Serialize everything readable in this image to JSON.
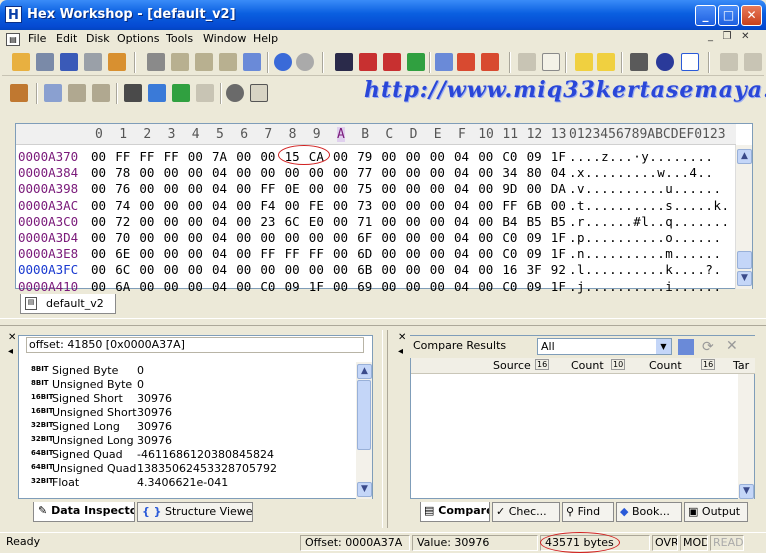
{
  "window": {
    "title": "Hex Workshop - [default_v2]",
    "app_icon": "H"
  },
  "menu": [
    "File",
    "Edit",
    "Disk",
    "Options",
    "Tools",
    "Window",
    "Help"
  ],
  "watermark_url": "http://www.miq33kertasemaya.tk",
  "hex": {
    "col_headers": [
      "0",
      "1",
      "2",
      "3",
      "4",
      "5",
      "6",
      "7",
      "8",
      "9",
      "A",
      "B",
      "C",
      "D",
      "E",
      "F",
      "10",
      "11",
      "12",
      "13"
    ],
    "ascii_header": "0123456789ABCDEF0123",
    "rows": [
      {
        "addr": "0000A370",
        "bytes": [
          "00",
          "FF",
          "FF",
          "FF",
          "00",
          "7A",
          "00",
          "00",
          "15",
          "CA",
          "00",
          "79",
          "00",
          "00",
          "00",
          "04",
          "00",
          "C0",
          "09",
          "1F"
        ],
        "ascii": "....z...·y........"
      },
      {
        "addr": "0000A384",
        "bytes": [
          "00",
          "78",
          "00",
          "00",
          "00",
          "04",
          "00",
          "00",
          "00",
          "00",
          "00",
          "77",
          "00",
          "00",
          "00",
          "04",
          "00",
          "34",
          "80",
          "04"
        ],
        "ascii": ".x.........w...4.."
      },
      {
        "addr": "0000A398",
        "bytes": [
          "00",
          "76",
          "00",
          "00",
          "00",
          "04",
          "00",
          "FF",
          "0E",
          "00",
          "00",
          "75",
          "00",
          "00",
          "00",
          "04",
          "00",
          "9D",
          "00",
          "DA"
        ],
        "ascii": ".v..........u......"
      },
      {
        "addr": "0000A3AC",
        "bytes": [
          "00",
          "74",
          "00",
          "00",
          "00",
          "04",
          "00",
          "F4",
          "00",
          "FE",
          "00",
          "73",
          "00",
          "00",
          "00",
          "04",
          "00",
          "FF",
          "6B",
          "00"
        ],
        "ascii": ".t..........s.....k."
      },
      {
        "addr": "0000A3C0",
        "bytes": [
          "00",
          "72",
          "00",
          "00",
          "00",
          "04",
          "00",
          "23",
          "6C",
          "E0",
          "00",
          "71",
          "00",
          "00",
          "00",
          "04",
          "00",
          "B4",
          "B5",
          "B5"
        ],
        "ascii": ".r......#l..q......."
      },
      {
        "addr": "0000A3D4",
        "bytes": [
          "00",
          "70",
          "00",
          "00",
          "00",
          "04",
          "00",
          "00",
          "00",
          "00",
          "00",
          "6F",
          "00",
          "00",
          "00",
          "04",
          "00",
          "C0",
          "09",
          "1F"
        ],
        "ascii": ".p..........o......"
      },
      {
        "addr": "0000A3E8",
        "bytes": [
          "00",
          "6E",
          "00",
          "00",
          "00",
          "04",
          "00",
          "FF",
          "FF",
          "FF",
          "00",
          "6D",
          "00",
          "00",
          "00",
          "04",
          "00",
          "C0",
          "09",
          "1F"
        ],
        "ascii": ".n..........m......"
      },
      {
        "addr": "0000A3FC",
        "bytes": [
          "00",
          "6C",
          "00",
          "00",
          "00",
          "04",
          "00",
          "00",
          "00",
          "00",
          "00",
          "6B",
          "00",
          "00",
          "00",
          "04",
          "00",
          "16",
          "3F",
          "92"
        ],
        "ascii": ".l..........k....?."
      },
      {
        "addr": "0000A410",
        "bytes": [
          "00",
          "6A",
          "00",
          "00",
          "00",
          "04",
          "00",
          "C0",
          "09",
          "1F",
          "00",
          "69",
          "00",
          "00",
          "00",
          "04",
          "00",
          "C0",
          "09",
          "1F"
        ],
        "ascii": ".j..........i......"
      }
    ]
  },
  "doc_tab": "default_v2",
  "inspector": {
    "offset_label": "offset: 41850 [0x0000A37A]",
    "rows": [
      {
        "bits": "8BIT",
        "name": "Signed Byte",
        "value": "0"
      },
      {
        "bits": "8BIT",
        "name": "Unsigned Byte",
        "value": "0"
      },
      {
        "bits": "16BIT",
        "name": "Signed Short",
        "value": "30976"
      },
      {
        "bits": "16BIT",
        "name": "Unsigned Short",
        "value": "30976"
      },
      {
        "bits": "32BIT",
        "name": "Signed Long",
        "value": "30976"
      },
      {
        "bits": "32BIT",
        "name": "Unsigned Long",
        "value": "30976"
      },
      {
        "bits": "64BIT",
        "name": "Signed Quad",
        "value": "-4611686120380845824"
      },
      {
        "bits": "64BIT",
        "name": "Unsigned Quad",
        "value": "13835062453328705792"
      },
      {
        "bits": "32BIT",
        "name": "Float",
        "value": "4.3406621e-041"
      }
    ],
    "tabs": [
      "Data Inspector",
      "Structure Viewer"
    ]
  },
  "compare": {
    "label": "Compare Results",
    "filter": "All",
    "columns": [
      "Source",
      "Count",
      "Count",
      "Tar"
    ],
    "tabs": [
      "Compare",
      "Chec...",
      "Find",
      "Book...",
      "Output"
    ]
  },
  "status": {
    "ready": "Ready",
    "offset": "Offset: 0000A37A",
    "value": "Value: 30976",
    "size": "43571 bytes",
    "ovr": "OVR",
    "mod": "MOD",
    "read": "READ"
  }
}
